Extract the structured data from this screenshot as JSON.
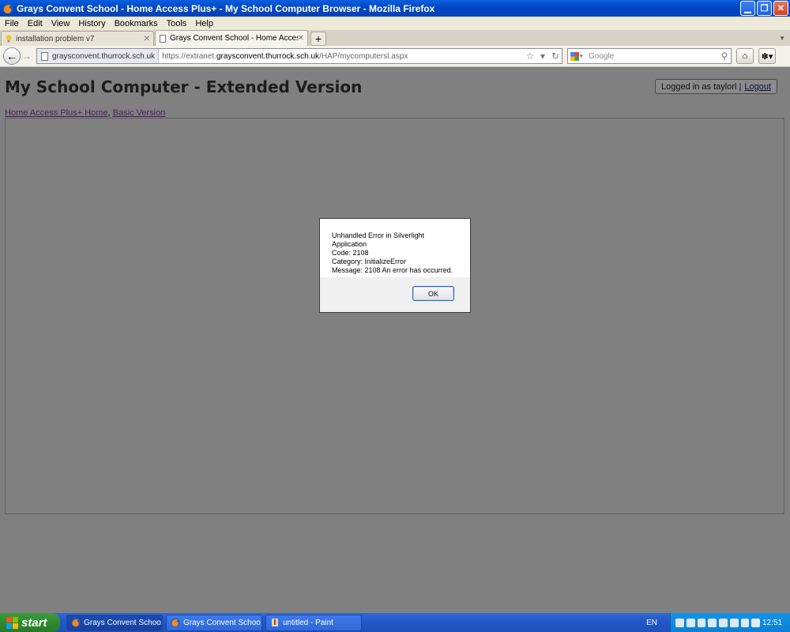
{
  "window": {
    "title": "Grays Convent School - Home Access Plus+ - My School Computer Browser - Mozilla Firefox",
    "minimize": "▁",
    "maximize": "❐",
    "close": "✕"
  },
  "menu": [
    "File",
    "Edit",
    "View",
    "History",
    "Bookmarks",
    "Tools",
    "Help"
  ],
  "tabs": [
    {
      "label": "installation problem v7",
      "active": false
    },
    {
      "label": "Grays Convent School - Home Access Plu...",
      "active": true
    }
  ],
  "new_tab": "+",
  "navbar": {
    "identity": "graysconvent.thurrock.sch.uk",
    "url_prefix": "https://extranet.",
    "url_domain": "graysconvent.thurrock.sch.uk",
    "url_path": "/HAP/mycomputersl.aspx",
    "search_placeholder": "Google"
  },
  "page": {
    "title": "My School Computer - Extended Version",
    "login_text": "Logged in as taylorl |",
    "logout": "Logout",
    "breadcrumb_home": "Home Access Plus+ Home",
    "breadcrumb_sep": ",",
    "breadcrumb_basic": "Basic Version"
  },
  "dialog": {
    "line1": "Unhandled Error in Silverlight Application",
    "line2": "Code: 2108",
    "line3": "Category: InitializeError",
    "line4": "Message: 2108 An error has occurred.",
    "ok": "OK"
  },
  "taskbar": {
    "start": "start",
    "tasks": [
      "Grays Convent Schoo...",
      "Grays Convent Schoo...",
      "untitled - Paint"
    ],
    "language": "EN",
    "clock": "12:51"
  }
}
